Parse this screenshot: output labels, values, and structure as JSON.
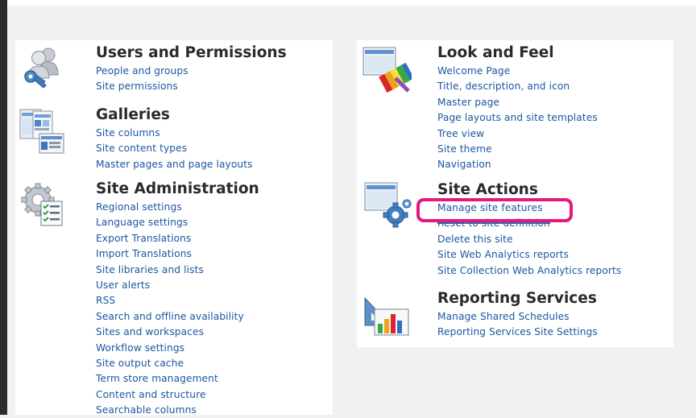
{
  "sections": {
    "users": {
      "title": "Users and Permissions",
      "icon": "users-icon",
      "links": [
        "People and groups",
        "Site permissions"
      ]
    },
    "galleries": {
      "title": "Galleries",
      "icon": "galleries-icon",
      "links": [
        "Site columns",
        "Site content types",
        "Master pages and page layouts"
      ]
    },
    "admin": {
      "title": "Site Administration",
      "icon": "site-admin-icon",
      "links": [
        "Regional settings",
        "Language settings",
        "Export Translations",
        "Import Translations",
        "Site libraries and lists",
        "User alerts",
        "RSS",
        "Search and offline availability",
        "Sites and workspaces",
        "Workflow settings",
        "Site output cache",
        "Term store management",
        "Content and structure",
        "Searchable columns"
      ]
    },
    "look": {
      "title": "Look and Feel",
      "icon": "look-and-feel-icon",
      "links": [
        "Welcome Page",
        "Title, description, and icon",
        "Master page",
        "Page layouts and site templates",
        "Tree view",
        "Site theme",
        "Navigation"
      ]
    },
    "actions": {
      "title": "Site Actions",
      "icon": "site-actions-icon",
      "links": [
        "Manage site features",
        "Reset to site definition",
        "Delete this site",
        "Site Web Analytics reports",
        "Site Collection Web Analytics reports"
      ]
    },
    "reporting": {
      "title": "Reporting Services",
      "icon": "reporting-services-icon",
      "links": [
        "Manage Shared Schedules",
        "Reporting Services Site Settings"
      ]
    }
  },
  "colors": {
    "link": "#1b57a0",
    "heading": "#2a2a2a",
    "highlight": "#e8177e",
    "background": "#f1f1f1",
    "panel": "#ffffff"
  }
}
